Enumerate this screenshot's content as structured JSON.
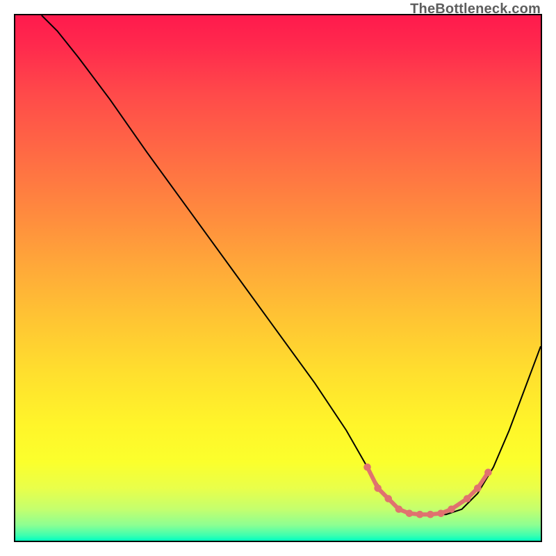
{
  "attribution": "TheBottleneck.com",
  "chart_data": {
    "type": "line",
    "title": "",
    "xlabel": "",
    "ylabel": "",
    "xlim": [
      0,
      100
    ],
    "ylim": [
      0,
      100
    ],
    "grid": false,
    "legend": false,
    "background": {
      "type": "vertical-gradient",
      "stops": [
        {
          "pos": 0,
          "color": "#ff1a4d"
        },
        {
          "pos": 50,
          "color": "#ffc533"
        },
        {
          "pos": 85,
          "color": "#fbff2c"
        },
        {
          "pos": 100,
          "color": "#00ffbf"
        }
      ],
      "meaning": "red = high bottleneck, green = low bottleneck"
    },
    "series": [
      {
        "name": "bottleneck-curve",
        "color": "#000000",
        "x": [
          5,
          8,
          12,
          18,
          25,
          33,
          41,
          49,
          57,
          63,
          67,
          70,
          73,
          76,
          79,
          82,
          85,
          88,
          91,
          94,
          97,
          100
        ],
        "y": [
          100,
          97,
          92,
          84,
          74,
          63,
          52,
          41,
          30,
          21,
          14,
          9,
          6,
          5,
          5,
          5,
          6,
          9,
          14,
          21,
          29,
          37
        ]
      }
    ],
    "markers": {
      "name": "optimal-range",
      "color": "#e0726f",
      "shape": "circle",
      "points": [
        {
          "x": 67,
          "y": 14
        },
        {
          "x": 69,
          "y": 10
        },
        {
          "x": 71,
          "y": 8
        },
        {
          "x": 73,
          "y": 6
        },
        {
          "x": 75,
          "y": 5.2
        },
        {
          "x": 77,
          "y": 5
        },
        {
          "x": 79,
          "y": 5
        },
        {
          "x": 81,
          "y": 5.2
        },
        {
          "x": 83,
          "y": 6
        },
        {
          "x": 86,
          "y": 8
        },
        {
          "x": 88,
          "y": 10
        },
        {
          "x": 90,
          "y": 13
        }
      ]
    }
  }
}
